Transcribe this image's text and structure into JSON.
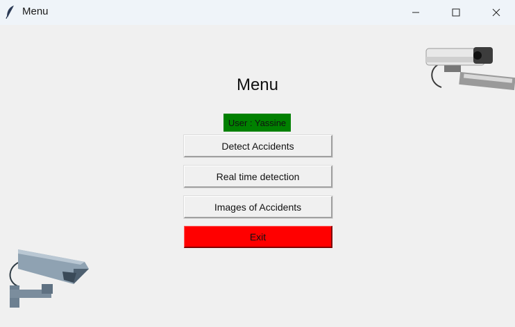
{
  "window": {
    "title": "Menu",
    "app_icon": "feather-icon",
    "controls": [
      "minimize-icon",
      "maximize-icon",
      "close-icon"
    ]
  },
  "menu": {
    "heading": "Menu",
    "user_label": "User : Yassine",
    "user_label_bg": "#008000",
    "buttons": {
      "detect": "Detect Accidents",
      "realtime": "Real time detection",
      "images": "Images of Accidents",
      "exit": "Exit"
    },
    "exit_color": "#ff0000"
  },
  "decorations": [
    "security-camera-icon",
    "security-camera-icon"
  ]
}
